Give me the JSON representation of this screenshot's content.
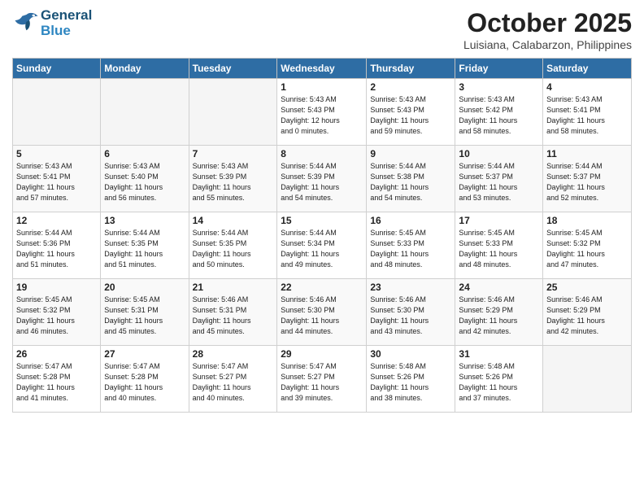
{
  "header": {
    "logo_line1": "General",
    "logo_line2": "Blue",
    "month": "October 2025",
    "location": "Luisiana, Calabarzon, Philippines"
  },
  "weekdays": [
    "Sunday",
    "Monday",
    "Tuesday",
    "Wednesday",
    "Thursday",
    "Friday",
    "Saturday"
  ],
  "weeks": [
    [
      {
        "day": "",
        "info": ""
      },
      {
        "day": "",
        "info": ""
      },
      {
        "day": "",
        "info": ""
      },
      {
        "day": "1",
        "info": "Sunrise: 5:43 AM\nSunset: 5:43 PM\nDaylight: 12 hours\nand 0 minutes."
      },
      {
        "day": "2",
        "info": "Sunrise: 5:43 AM\nSunset: 5:43 PM\nDaylight: 11 hours\nand 59 minutes."
      },
      {
        "day": "3",
        "info": "Sunrise: 5:43 AM\nSunset: 5:42 PM\nDaylight: 11 hours\nand 58 minutes."
      },
      {
        "day": "4",
        "info": "Sunrise: 5:43 AM\nSunset: 5:41 PM\nDaylight: 11 hours\nand 58 minutes."
      }
    ],
    [
      {
        "day": "5",
        "info": "Sunrise: 5:43 AM\nSunset: 5:41 PM\nDaylight: 11 hours\nand 57 minutes."
      },
      {
        "day": "6",
        "info": "Sunrise: 5:43 AM\nSunset: 5:40 PM\nDaylight: 11 hours\nand 56 minutes."
      },
      {
        "day": "7",
        "info": "Sunrise: 5:43 AM\nSunset: 5:39 PM\nDaylight: 11 hours\nand 55 minutes."
      },
      {
        "day": "8",
        "info": "Sunrise: 5:44 AM\nSunset: 5:39 PM\nDaylight: 11 hours\nand 54 minutes."
      },
      {
        "day": "9",
        "info": "Sunrise: 5:44 AM\nSunset: 5:38 PM\nDaylight: 11 hours\nand 54 minutes."
      },
      {
        "day": "10",
        "info": "Sunrise: 5:44 AM\nSunset: 5:37 PM\nDaylight: 11 hours\nand 53 minutes."
      },
      {
        "day": "11",
        "info": "Sunrise: 5:44 AM\nSunset: 5:37 PM\nDaylight: 11 hours\nand 52 minutes."
      }
    ],
    [
      {
        "day": "12",
        "info": "Sunrise: 5:44 AM\nSunset: 5:36 PM\nDaylight: 11 hours\nand 51 minutes."
      },
      {
        "day": "13",
        "info": "Sunrise: 5:44 AM\nSunset: 5:35 PM\nDaylight: 11 hours\nand 51 minutes."
      },
      {
        "day": "14",
        "info": "Sunrise: 5:44 AM\nSunset: 5:35 PM\nDaylight: 11 hours\nand 50 minutes."
      },
      {
        "day": "15",
        "info": "Sunrise: 5:44 AM\nSunset: 5:34 PM\nDaylight: 11 hours\nand 49 minutes."
      },
      {
        "day": "16",
        "info": "Sunrise: 5:45 AM\nSunset: 5:33 PM\nDaylight: 11 hours\nand 48 minutes."
      },
      {
        "day": "17",
        "info": "Sunrise: 5:45 AM\nSunset: 5:33 PM\nDaylight: 11 hours\nand 48 minutes."
      },
      {
        "day": "18",
        "info": "Sunrise: 5:45 AM\nSunset: 5:32 PM\nDaylight: 11 hours\nand 47 minutes."
      }
    ],
    [
      {
        "day": "19",
        "info": "Sunrise: 5:45 AM\nSunset: 5:32 PM\nDaylight: 11 hours\nand 46 minutes."
      },
      {
        "day": "20",
        "info": "Sunrise: 5:45 AM\nSunset: 5:31 PM\nDaylight: 11 hours\nand 45 minutes."
      },
      {
        "day": "21",
        "info": "Sunrise: 5:46 AM\nSunset: 5:31 PM\nDaylight: 11 hours\nand 45 minutes."
      },
      {
        "day": "22",
        "info": "Sunrise: 5:46 AM\nSunset: 5:30 PM\nDaylight: 11 hours\nand 44 minutes."
      },
      {
        "day": "23",
        "info": "Sunrise: 5:46 AM\nSunset: 5:30 PM\nDaylight: 11 hours\nand 43 minutes."
      },
      {
        "day": "24",
        "info": "Sunrise: 5:46 AM\nSunset: 5:29 PM\nDaylight: 11 hours\nand 42 minutes."
      },
      {
        "day": "25",
        "info": "Sunrise: 5:46 AM\nSunset: 5:29 PM\nDaylight: 11 hours\nand 42 minutes."
      }
    ],
    [
      {
        "day": "26",
        "info": "Sunrise: 5:47 AM\nSunset: 5:28 PM\nDaylight: 11 hours\nand 41 minutes."
      },
      {
        "day": "27",
        "info": "Sunrise: 5:47 AM\nSunset: 5:28 PM\nDaylight: 11 hours\nand 40 minutes."
      },
      {
        "day": "28",
        "info": "Sunrise: 5:47 AM\nSunset: 5:27 PM\nDaylight: 11 hours\nand 40 minutes."
      },
      {
        "day": "29",
        "info": "Sunrise: 5:47 AM\nSunset: 5:27 PM\nDaylight: 11 hours\nand 39 minutes."
      },
      {
        "day": "30",
        "info": "Sunrise: 5:48 AM\nSunset: 5:26 PM\nDaylight: 11 hours\nand 38 minutes."
      },
      {
        "day": "31",
        "info": "Sunrise: 5:48 AM\nSunset: 5:26 PM\nDaylight: 11 hours\nand 37 minutes."
      },
      {
        "day": "",
        "info": ""
      }
    ]
  ]
}
